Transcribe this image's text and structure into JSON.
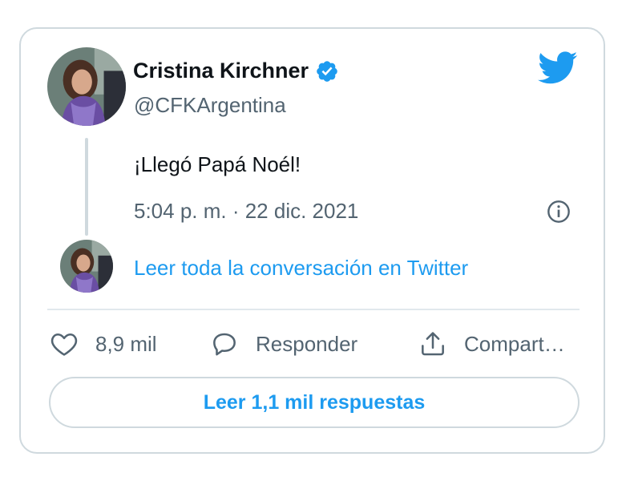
{
  "tweet": {
    "author": {
      "name": "Cristina Kirchner",
      "handle": "@CFKArgentina",
      "verified": true,
      "avatar_icon": "profile-photo"
    },
    "text": "¡Llegó Papá Noél!",
    "timestamp": "5:04 p. m. · 22 dic. 2021",
    "read_conversation": "Leer toda la conversación en Twitter",
    "actions": {
      "like_count": "8,9 mil",
      "reply_label": "Responder",
      "share_label": "Compart…"
    },
    "read_replies": "Leer 1,1 mil respuestas"
  },
  "icons": {
    "brand": "twitter-bird-icon",
    "verified": "verified-badge-icon",
    "info": "info-icon",
    "like": "heart-icon",
    "reply": "speech-bubble-icon",
    "share": "share-icon"
  },
  "colors": {
    "accent": "#1d9bf0",
    "text": "#0f1419",
    "secondary_text": "#536471",
    "border": "#cfd9de"
  }
}
